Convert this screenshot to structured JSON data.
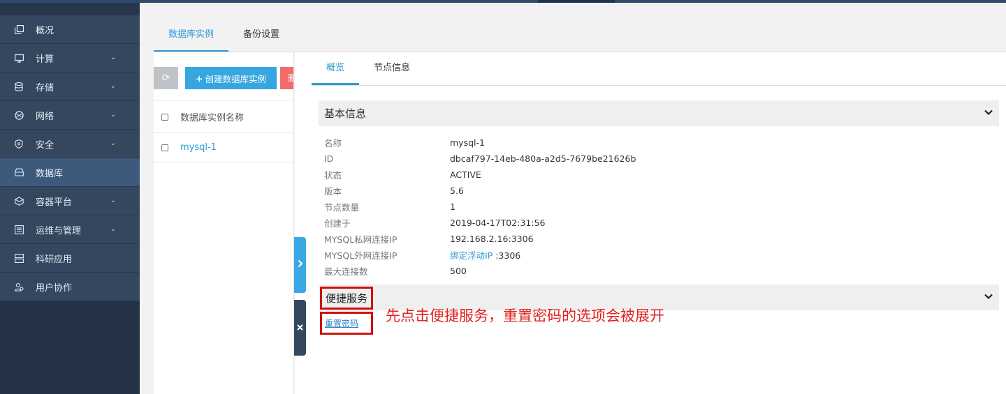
{
  "sidebar": {
    "items": [
      {
        "label": "概况",
        "icon": "copy-icon",
        "expandable": false
      },
      {
        "label": "计算",
        "icon": "monitor-icon",
        "expandable": true
      },
      {
        "label": "存储",
        "icon": "database-icon",
        "expandable": true
      },
      {
        "label": "网络",
        "icon": "network-icon",
        "expandable": true
      },
      {
        "label": "安全",
        "icon": "shield-icon",
        "expandable": true
      },
      {
        "label": "数据库",
        "icon": "drive-icon",
        "expandable": false,
        "active": true
      },
      {
        "label": "容器平台",
        "icon": "container-icon",
        "expandable": true
      },
      {
        "label": "运维与管理",
        "icon": "list-icon",
        "expandable": true
      },
      {
        "label": "科研应用",
        "icon": "server-icon",
        "expandable": false
      },
      {
        "label": "用户协作",
        "icon": "users-icon",
        "expandable": false
      }
    ]
  },
  "main_tabs": [
    {
      "label": "数据库实例",
      "active": true
    },
    {
      "label": "备份设置",
      "active": false
    }
  ],
  "toolbar": {
    "create_label": "创建数据库实例",
    "delete_label": "删"
  },
  "list": {
    "header": "数据库实例名称",
    "rows": [
      {
        "name": "mysql-1"
      }
    ]
  },
  "detail": {
    "tabs": [
      {
        "label": "概览",
        "active": true
      },
      {
        "label": "节点信息",
        "active": false
      }
    ],
    "basic_section_title": "基本信息",
    "info": [
      {
        "key": "名称",
        "value": "mysql-1"
      },
      {
        "key": "ID",
        "value": "dbcaf797-14eb-480a-a2d5-7679be21626b"
      },
      {
        "key": "状态",
        "value": "ACTIVE"
      },
      {
        "key": "版本",
        "value": "5.6"
      },
      {
        "key": "节点数量",
        "value": "1"
      },
      {
        "key": "创建于",
        "value": "2019-04-17T02:31:56"
      },
      {
        "key": "MYSQL私网连接IP",
        "value": "192.168.2.16:3306"
      },
      {
        "key": "MYSQL外网连接IP",
        "link": "绑定浮动IP",
        "value": ":3306"
      },
      {
        "key": "最大连接数",
        "value": "500"
      }
    ],
    "quick_section_title": "便捷服务",
    "reset_password_label": "重置密码"
  },
  "annotation": "先点击便捷服务，重置密码的选项会被展开",
  "colors": {
    "accent": "#2f9bd6",
    "sidebar_bg": "#34475f",
    "sidebar_active": "#3d5a7d",
    "highlight": "#d01010",
    "create_button": "#35a6e0",
    "delete_button": "#f26b6b"
  }
}
